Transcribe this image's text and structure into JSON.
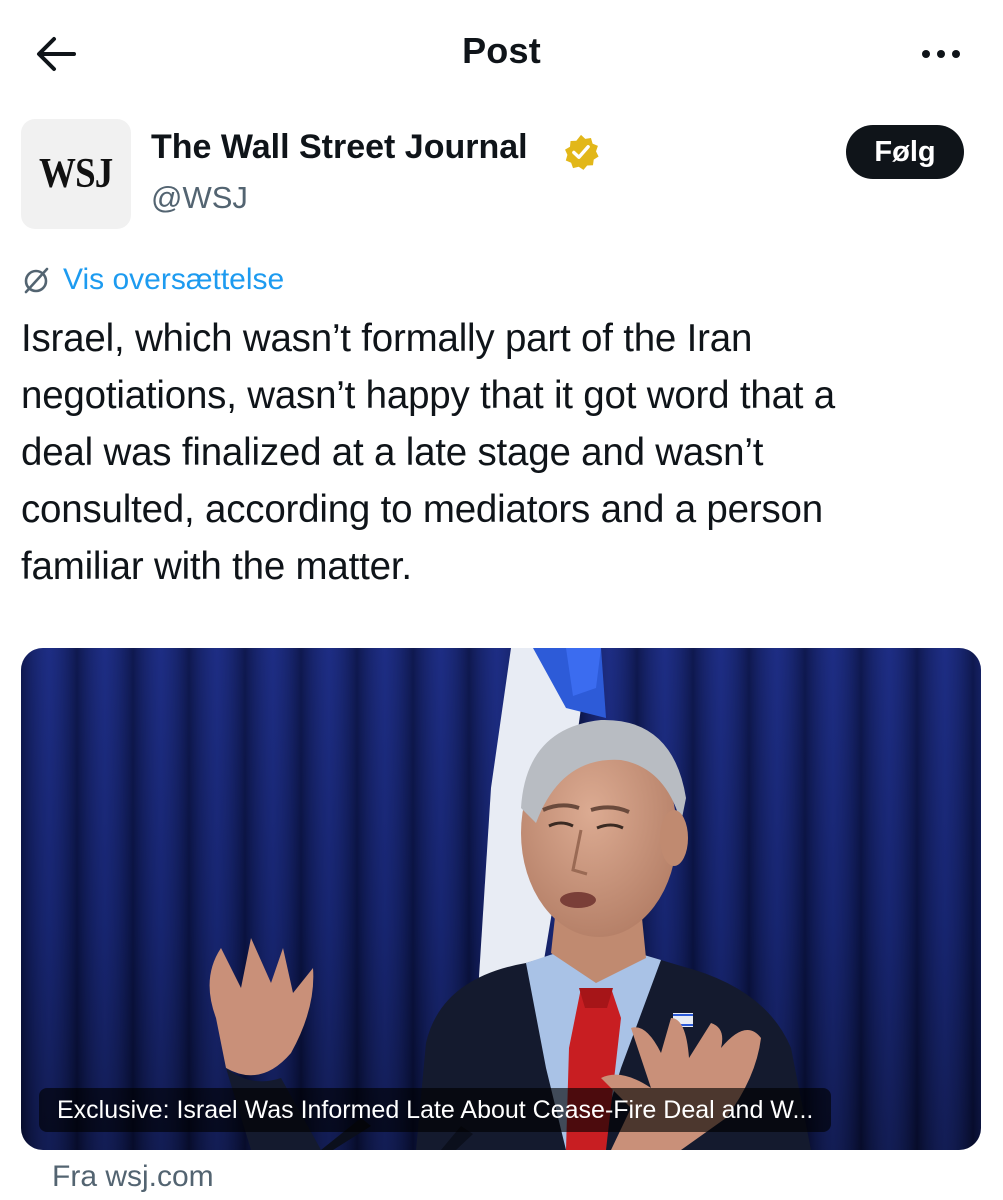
{
  "header": {
    "title": "Post",
    "back_icon": "arrow-left-icon",
    "more_icon": "more-horizontal-icon"
  },
  "author": {
    "avatar_text": "WSJ",
    "name": "The Wall Street Journal",
    "handle": "@WSJ",
    "verified": true,
    "verified_color": "#e2b719",
    "follow_label": "Følg"
  },
  "translate": {
    "label": "Vis oversættelse",
    "icon": "globe-slash-icon"
  },
  "post": {
    "lines": [
      "Israel, which wasn’t formally part of the Iran",
      "negotiations, wasn’t happy that it got word that a",
      "deal was finalized at a late stage and wasn’t",
      "consulted, according to mediators and a person",
      "familiar with the matter."
    ]
  },
  "card": {
    "headline": "Exclusive: Israel Was Informed Late About Cease-Fire Deal and W...",
    "source": "Fra wsj.com",
    "image_description_icon": "photo-icon"
  },
  "colors": {
    "accent": "#1d9bf0",
    "text": "#0f1419",
    "muted": "#536471"
  }
}
